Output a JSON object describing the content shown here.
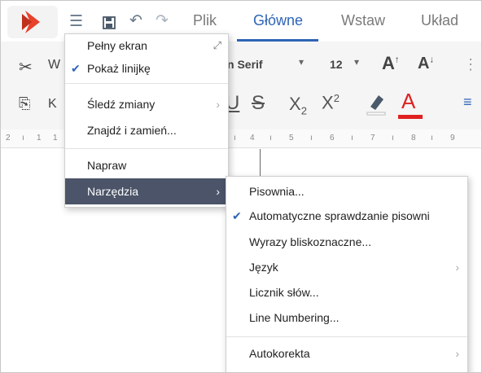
{
  "header": {
    "tabs": [
      "Plik",
      "Główne",
      "Wstaw",
      "Układ"
    ],
    "active_tab": "Główne"
  },
  "toolbar": {
    "cut_label_fragment": "W",
    "copy_label_fragment": "K",
    "font_name": "n Serif",
    "font_size": "12",
    "underline": "U",
    "strikethrough": "S",
    "subscript": "X",
    "subscript_mark": "2",
    "superscript": "X",
    "superscript_mark": "2",
    "text_color": "A",
    "font_color_hex": "#e02020"
  },
  "ruler": {
    "ticks": [
      "2",
      "1",
      "1",
      "4",
      "5",
      "6",
      "7",
      "8",
      "9"
    ]
  },
  "menu": {
    "items": [
      {
        "label": "Pełny ekran"
      },
      {
        "label": "Pokaż linijkę",
        "checked": true
      },
      {
        "label": "Śledź zmiany"
      },
      {
        "label": "Znajdź i zamień..."
      },
      {
        "label": "Napraw"
      },
      {
        "label": "Narzędzia",
        "highlighted": true
      }
    ]
  },
  "submenu": {
    "items": [
      {
        "label": "Pisownia..."
      },
      {
        "label": "Automatyczne sprawdzanie pisowni",
        "checked": true
      },
      {
        "label": "Wyrazy bliskoznaczne..."
      },
      {
        "label": "Język"
      },
      {
        "label": "Licznik słów..."
      },
      {
        "label": "Line Numbering..."
      },
      {
        "label": "Autokorekta"
      }
    ]
  },
  "colors": {
    "accent": "#2e64b6",
    "highlight": "#4b5468",
    "brand": "#e8412c"
  }
}
